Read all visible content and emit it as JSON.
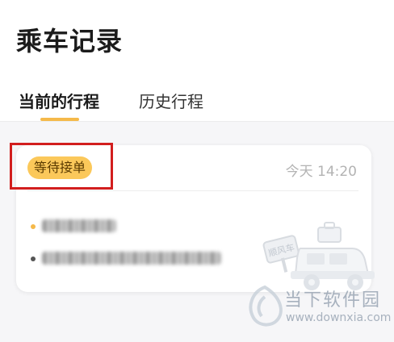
{
  "header": {
    "title": "乘车记录"
  },
  "tabs": [
    {
      "label": "当前的行程",
      "active": true
    },
    {
      "label": "历史行程",
      "active": false
    }
  ],
  "order": {
    "status": "等待接单",
    "time": "今天 14:20",
    "start_location": "",
    "end_location": ""
  },
  "illustration": {
    "stamp_text": "顺风车"
  },
  "watermark": {
    "brand": "当下软件园",
    "url": "www.downxia.com"
  },
  "colors": {
    "accent": "#f5b94a",
    "badge_bg": "#fbc85a",
    "highlight": "#d21e1e"
  }
}
